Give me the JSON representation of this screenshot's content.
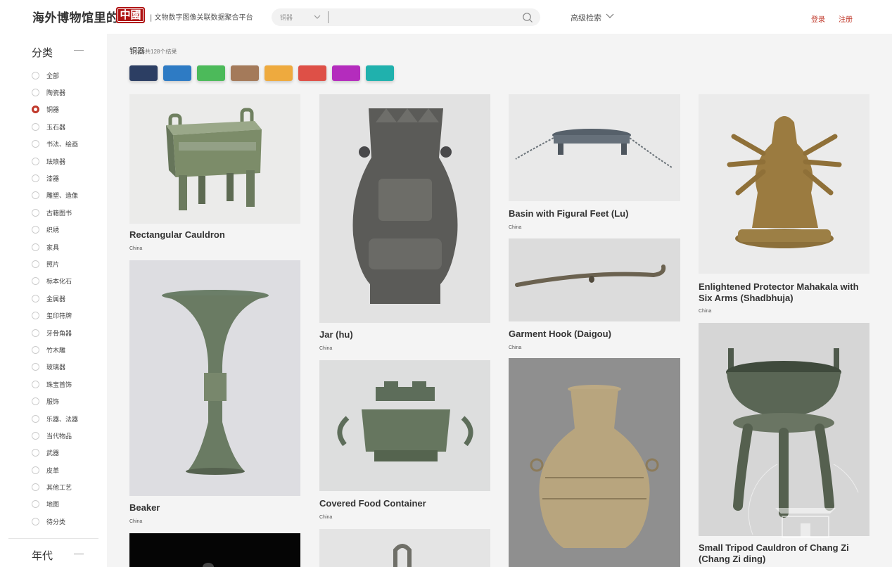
{
  "header": {
    "site_title": "海外博物馆里的",
    "logo_text": "中國",
    "subtitle": "| 文物数字图像关联数据聚合平台",
    "search_type": "铜器",
    "search_value": "",
    "adv_search": "高级检索",
    "login": "登录",
    "register": "注册"
  },
  "sidebar": {
    "category_title": "分类",
    "collapse_symbol": "—",
    "categories": [
      {
        "label": "全部",
        "checked": false
      },
      {
        "label": "陶瓷器",
        "checked": false
      },
      {
        "label": "铜器",
        "checked": true
      },
      {
        "label": "玉石器",
        "checked": false
      },
      {
        "label": "书法、绘画",
        "checked": false
      },
      {
        "label": "珐琅器",
        "checked": false
      },
      {
        "label": "漆器",
        "checked": false
      },
      {
        "label": "雕塑、造像",
        "checked": false
      },
      {
        "label": "古籍图书",
        "checked": false
      },
      {
        "label": "织绣",
        "checked": false
      },
      {
        "label": "家具",
        "checked": false
      },
      {
        "label": "照片",
        "checked": false
      },
      {
        "label": "标本化石",
        "checked": false
      },
      {
        "label": "金属器",
        "checked": false
      },
      {
        "label": "玺印符牌",
        "checked": false
      },
      {
        "label": "牙骨角器",
        "checked": false
      },
      {
        "label": "竹木雕",
        "checked": false
      },
      {
        "label": "玻璃器",
        "checked": false
      },
      {
        "label": "珠宝首饰",
        "checked": false
      },
      {
        "label": "服饰",
        "checked": false
      },
      {
        "label": "乐器、法器",
        "checked": false
      },
      {
        "label": "当代物品",
        "checked": false
      },
      {
        "label": "武器",
        "checked": false
      },
      {
        "label": "皮革",
        "checked": false
      },
      {
        "label": "其他工艺",
        "checked": false
      },
      {
        "label": "地图",
        "checked": false
      },
      {
        "label": "待分类",
        "checked": false
      }
    ],
    "era_title": "年代"
  },
  "results": {
    "category": "铜器",
    "count_text": "共128个结果"
  },
  "color_filters": [
    "#2c3e63",
    "#2e7bc4",
    "#4cba5a",
    "#a47a5a",
    "#eeaa3e",
    "#de5047",
    "#b42cbd",
    "#20b1ad"
  ],
  "items": [
    {
      "title": "Rectangular Cauldron",
      "origin": "China"
    },
    {
      "title": "Beaker",
      "origin": "China"
    },
    {
      "title": "",
      "origin": ""
    },
    {
      "title": "Jar (hu)",
      "origin": "China"
    },
    {
      "title": "Covered Food Container",
      "origin": "China"
    },
    {
      "title": "",
      "origin": ""
    },
    {
      "title": "Basin with Figural Feet (Lu)",
      "origin": "China"
    },
    {
      "title": "Garment Hook (Daigou)",
      "origin": "China"
    },
    {
      "title": "",
      "origin": ""
    },
    {
      "title": "Enlightened Protector Mahakala with Six Arms (Shadbhuja)",
      "origin": "China"
    },
    {
      "title": "Small Tripod Cauldron of Chang Zi (Chang Zi ding)",
      "origin": ""
    }
  ]
}
